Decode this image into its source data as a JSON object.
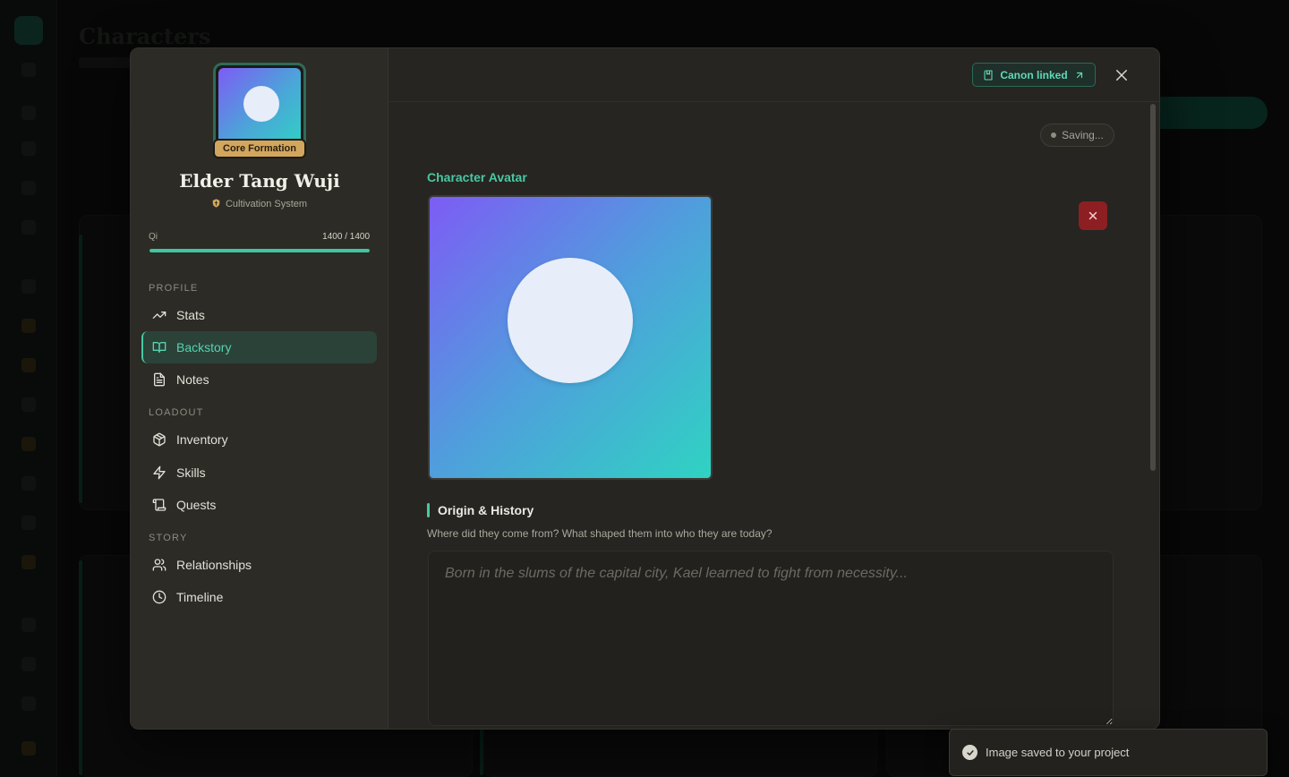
{
  "background": {
    "page_title": "Characters"
  },
  "character": {
    "rank": "Core Formation",
    "name": "Elder Tang Wuji",
    "system": "Cultivation System",
    "qi_label": "Qi",
    "qi_value": "1400 / 1400",
    "qi_fraction": 1.0
  },
  "sidebar": {
    "sections": [
      {
        "label": "PROFILE",
        "items": [
          {
            "label": "Stats",
            "icon": "trending-up-icon"
          },
          {
            "label": "Backstory",
            "icon": "book-open-icon",
            "active": true
          },
          {
            "label": "Notes",
            "icon": "file-text-icon"
          }
        ]
      },
      {
        "label": "LOADOUT",
        "items": [
          {
            "label": "Inventory",
            "icon": "package-icon"
          },
          {
            "label": "Skills",
            "icon": "zap-icon"
          },
          {
            "label": "Quests",
            "icon": "scroll-icon"
          }
        ]
      },
      {
        "label": "STORY",
        "items": [
          {
            "label": "Relationships",
            "icon": "users-icon"
          },
          {
            "label": "Timeline",
            "icon": "clock-icon"
          }
        ]
      }
    ]
  },
  "header": {
    "canon_label": "Canon linked"
  },
  "content": {
    "saving_status": "Saving...",
    "avatar_title": "Character Avatar",
    "origin_title": "Origin & History",
    "origin_subtitle": "Where did they come from? What shaped them into who they are today?",
    "origin_placeholder": "Born in the slums of the capital city, Kael learned to fight from necessity..."
  },
  "toast": {
    "message": "Image saved to your project"
  },
  "colors": {
    "accent": "#48c8a3",
    "rank_badge": "#d3a65e",
    "danger": "#8d1f22"
  }
}
